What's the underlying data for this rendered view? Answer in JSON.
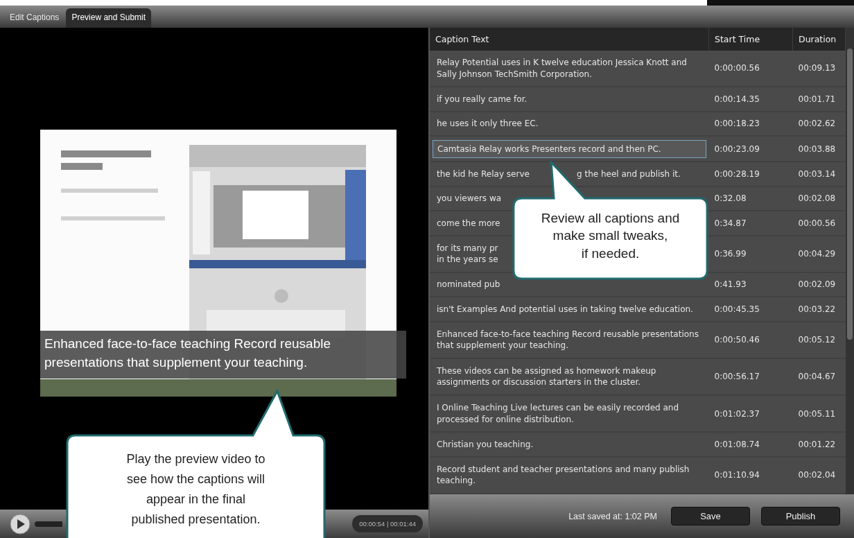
{
  "tabs": [
    {
      "label": "Edit Captions",
      "selected": false
    },
    {
      "label": "Preview and Submit",
      "selected": true
    }
  ],
  "preview": {
    "kind": "picture",
    "caption": "Enhanced face-to-face teaching Record reusable presentations that supplement your teaching."
  },
  "player": {
    "time": "00:00:54 | 00:01:44"
  },
  "table": {
    "columns": [
      "Caption Text",
      "Start Time",
      "Duration"
    ],
    "rows": [
      {
        "caption": [
          "Relay Potential uses in K twelve education Jessica Knott and Sally Johnson TechSmith Corporation."
        ],
        "start": "0:00:00.56",
        "duration": "00:09.13",
        "editing": false
      },
      {
        "caption": [
          "if you really came for."
        ],
        "start": "0:00:14.35",
        "duration": "00:01.71",
        "editing": false
      },
      {
        "caption": [
          "he uses it only three EC."
        ],
        "start": "0:00:18.23",
        "duration": "00:02.62",
        "editing": false
      },
      {
        "caption": [
          "Camtasia Relay works Presenters record and then PC."
        ],
        "start": "0:00:23.09",
        "duration": "00:03.88",
        "editing": true
      },
      {
        "caption": [
          "the kid he Relay serve",
          "g the heel and publish it."
        ],
        "start": "0:00:28.19",
        "duration": "00:03.14",
        "editing": false
      },
      {
        "caption": [
          "you viewers wa"
        ],
        "start": "0:32.08",
        "duration": "00:02.08",
        "editing": false
      },
      {
        "caption": [
          "come the more"
        ],
        "start": "0:34.87",
        "duration": "00:00.56",
        "editing": false
      },
      {
        "caption": [
          "for its many pr\nin the years se"
        ],
        "start": "0:36.99",
        "duration": "00:04.29",
        "editing": false
      },
      {
        "caption": [
          "nominated pub"
        ],
        "start": "0:41.93",
        "duration": "00:02.09",
        "editing": false
      },
      {
        "caption": [
          "isn't Examples And potential uses in taking twelve education."
        ],
        "start": "0:00:45.35",
        "duration": "00:03.22",
        "editing": false
      },
      {
        "caption": [
          "Enhanced face-to-face teaching Record reusable presentations that supplement your teaching."
        ],
        "start": "0:00:50.46",
        "duration": "00:05.12",
        "editing": false
      },
      {
        "caption": [
          "These videos can be assigned as homework makeup assignments or discussion starters in the cluster."
        ],
        "start": "0:00:56.17",
        "duration": "00:04.67",
        "editing": false
      },
      {
        "caption": [
          "I Online Teaching Live lectures can be easily recorded and processed for online distribution."
        ],
        "start": "0:01:02.37",
        "duration": "00:05.11",
        "editing": false
      },
      {
        "caption": [
          "Christian you teaching."
        ],
        "start": "0:01:08.74",
        "duration": "00:01.22",
        "editing": false
      },
      {
        "caption": [
          "Record student and teacher presentations and many publish teaching."
        ],
        "start": "0:01:10.94",
        "duration": "00:02.04",
        "editing": false
      }
    ]
  },
  "status_bar": {
    "last_saved": "Last saved at: 1:02 PM",
    "buttons": [
      "Save",
      "Publish"
    ]
  },
  "callouts": [
    "Review all captions and\nmake small tweaks,\nif needed.",
    "Play the preview video to\nsee how the captions will\nappear in the final\npublished presentation."
  ]
}
